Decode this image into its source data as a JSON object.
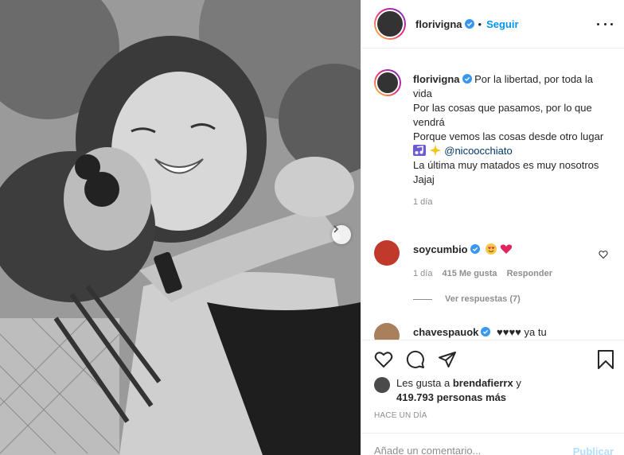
{
  "post": {
    "author": "florivigna",
    "follow_label": "Seguir",
    "separator": "•",
    "caption_lines": [
      "Por la libertad, por toda la vida",
      "Por las cosas que pasamos, por lo que vendrá",
      "Porque vemos las cosas desde otro lugar"
    ],
    "caption_emoji_icons": [
      "music-notes-icon",
      "sparkles-icon"
    ],
    "caption_mention": "@nicoocchiato",
    "caption_last": "La última muy matados es muy nosotros Jajaj",
    "caption_time": "1 día"
  },
  "comments": [
    {
      "user": "soycumbio",
      "emoji_icons": [
        "heart-eyes-icon",
        "heart-icon"
      ],
      "time": "1 día",
      "likes": "415 Me gusta",
      "reply_label": "Responder",
      "view_replies": "Ver respuestas (7)"
    },
    {
      "user": "chavespauok",
      "text_partial": "♥♥♥♥ ya tu"
    }
  ],
  "likes": {
    "prefix": "Les gusta a",
    "user": "brendafierrx",
    "suffix": "y",
    "count_text": "419.793 personas más"
  },
  "timestamp": "HACE UN DÍA",
  "add_comment": {
    "placeholder": "Añade un comentario...",
    "publish_label": "Publicar"
  },
  "colors": {
    "link_blue": "#0095f6",
    "publish_disabled": "#b2dffc",
    "muted_gray": "#8e8e8e",
    "mention": "#00376b"
  }
}
